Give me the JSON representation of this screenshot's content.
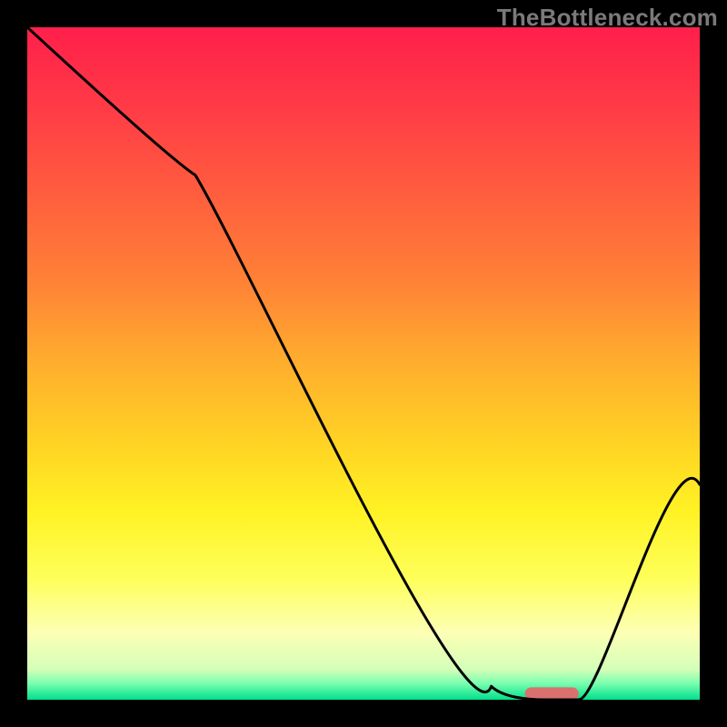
{
  "watermark": "TheBottleneck.com",
  "chart_data": {
    "type": "line",
    "title": "",
    "xlabel": "",
    "ylabel": "",
    "xlim": [
      0,
      100
    ],
    "ylim": [
      0,
      100
    ],
    "series": [
      {
        "name": "bottleneck-curve",
        "x": [
          0,
          25,
          69,
          77,
          82,
          100
        ],
        "y": [
          100,
          78,
          2,
          0,
          0,
          32
        ]
      }
    ],
    "marker": {
      "x_start": 74,
      "x_end": 82,
      "y": 0.9,
      "color": "#d9716e"
    },
    "gradient_stops": [
      {
        "offset": 0.0,
        "color": "#ff1f4b"
      },
      {
        "offset": 0.12,
        "color": "#ff3b46"
      },
      {
        "offset": 0.25,
        "color": "#ff5e3e"
      },
      {
        "offset": 0.38,
        "color": "#ff8236"
      },
      {
        "offset": 0.5,
        "color": "#ffae2d"
      },
      {
        "offset": 0.62,
        "color": "#ffd324"
      },
      {
        "offset": 0.72,
        "color": "#fff224"
      },
      {
        "offset": 0.82,
        "color": "#feff5a"
      },
      {
        "offset": 0.9,
        "color": "#fdffb5"
      },
      {
        "offset": 0.955,
        "color": "#d4ffb8"
      },
      {
        "offset": 0.975,
        "color": "#7dffb0"
      },
      {
        "offset": 1.0,
        "color": "#00e08c"
      }
    ],
    "curve_color": "#000000",
    "curve_width": 3
  }
}
